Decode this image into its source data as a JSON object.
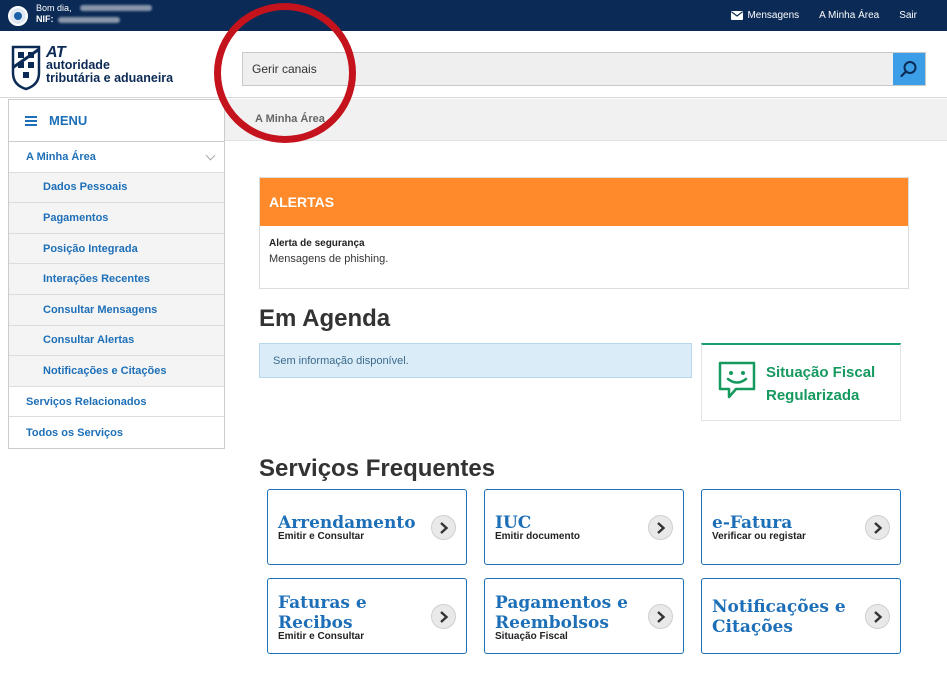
{
  "topbar": {
    "greeting": "Bom dia,",
    "nif_label": "NIF:",
    "links": {
      "messages": "Mensagens",
      "my_area": "A Minha Área",
      "logout": "Sair"
    }
  },
  "logo": {
    "at": "AT",
    "line1": "autoridade",
    "line2": "tributária e aduaneira"
  },
  "search": {
    "value": "Gerir canais"
  },
  "breadcrumb": "A Minha Área",
  "sidebar": {
    "menu_label": "MENU",
    "section": "A Minha Área",
    "sub_items": [
      "Dados Pessoais",
      "Pagamentos",
      "Posição Integrada",
      "Interações Recentes",
      "Consultar Mensagens",
      "Consultar Alertas",
      "Notificações e Citações"
    ],
    "other_items": [
      "Serviços Relacionados",
      "Todos os Serviços"
    ]
  },
  "alerts": {
    "title": "ALERTAS",
    "item_title": "Alerta de segurança",
    "item_text": "Mensagens de phishing."
  },
  "agenda": {
    "title": "Em Agenda",
    "empty": "Sem informação disponível."
  },
  "fiscal": {
    "line1": "Situação Fiscal",
    "line2": "Regularizada"
  },
  "frequent": {
    "title": "Serviços Frequentes",
    "cards": [
      {
        "title": "Arrendamento",
        "sub": "Emitir e Consultar"
      },
      {
        "title": "IUC",
        "sub": "Emitir documento"
      },
      {
        "title": "e-Fatura",
        "sub": "Verificar ou registar"
      },
      {
        "title": "Faturas e Recibos",
        "sub": "Emitir e Consultar"
      },
      {
        "title": "Pagamentos e Reembolsos",
        "sub": "Situação Fiscal"
      },
      {
        "title": "Notificações e Citações",
        "sub": ""
      }
    ]
  },
  "colors": {
    "topbar": "#0b2a55",
    "accent": "#1d6fb8",
    "alert": "#ff8a2b",
    "success": "#15995f",
    "annotation": "#c4131c"
  }
}
